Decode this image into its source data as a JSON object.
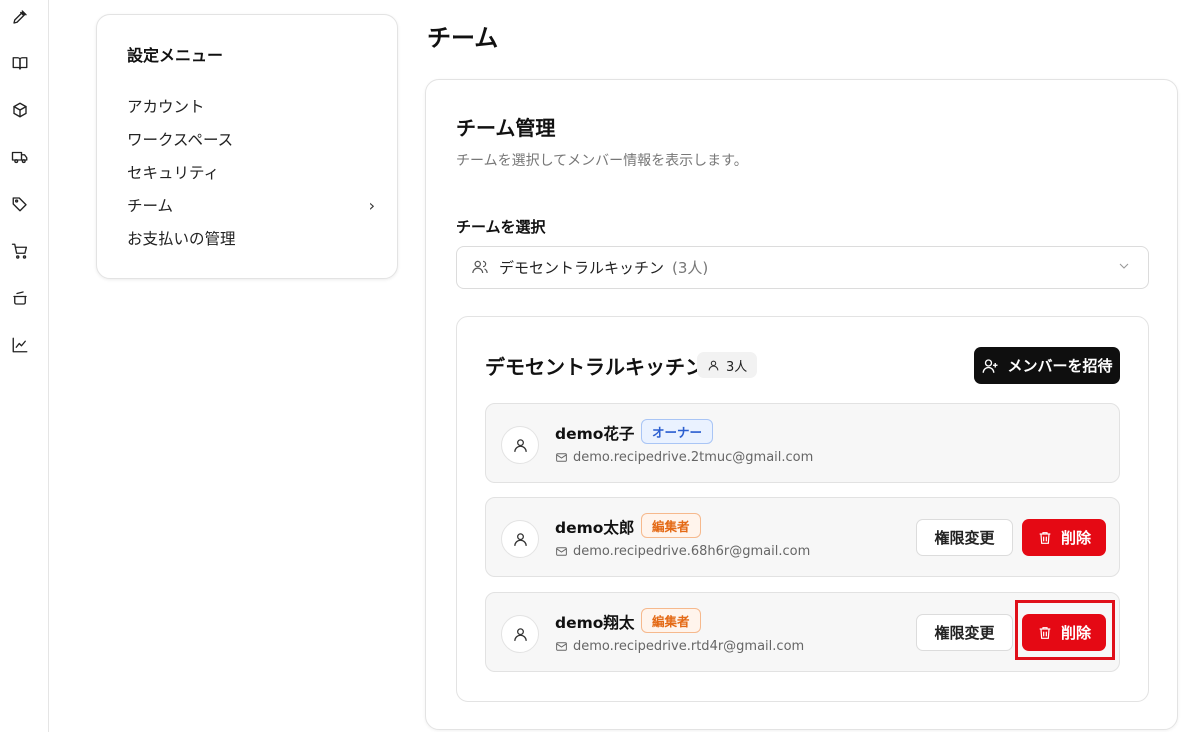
{
  "settings_menu": {
    "title": "設定メニュー",
    "items": [
      {
        "label": "アカウント"
      },
      {
        "label": "ワークスペース"
      },
      {
        "label": "セキュリティ"
      },
      {
        "label": "チーム",
        "active": true
      },
      {
        "label": "お支払いの管理"
      }
    ]
  },
  "page": {
    "title": "チーム"
  },
  "team_card": {
    "title": "チーム管理",
    "description": "チームを選択してメンバー情報を表示します。",
    "select_label": "チームを選択",
    "selected_team": {
      "name": "デモセントラルキッチン",
      "count": "(3人)"
    }
  },
  "members_card": {
    "team_name": "デモセントラルキッチン",
    "member_count": "3人",
    "invite_label": "メンバーを招待",
    "members": [
      {
        "name": "demo花子",
        "role": "オーナー",
        "role_type": "owner",
        "email": "demo.recipedrive.2tmuc@gmail.com"
      },
      {
        "name": "demo太郎",
        "role": "編集者",
        "role_type": "editor",
        "email": "demo.recipedrive.68h6r@gmail.com",
        "permission_label": "権限変更",
        "delete_label": "削除"
      },
      {
        "name": "demo翔太",
        "role": "編集者",
        "role_type": "editor",
        "email": "demo.recipedrive.rtd4r@gmail.com",
        "permission_label": "権限変更",
        "delete_label": "削除"
      }
    ]
  },
  "colors": {
    "delete": "#e50914",
    "owner_badge": "#2b5fd0",
    "editor_badge": "#e46a16",
    "invite": "#0f0f0f"
  },
  "icons": [
    "pen-icon",
    "book-icon",
    "box-icon",
    "truck-icon",
    "tag-icon",
    "cart-icon",
    "pot-icon",
    "chart-icon"
  ]
}
